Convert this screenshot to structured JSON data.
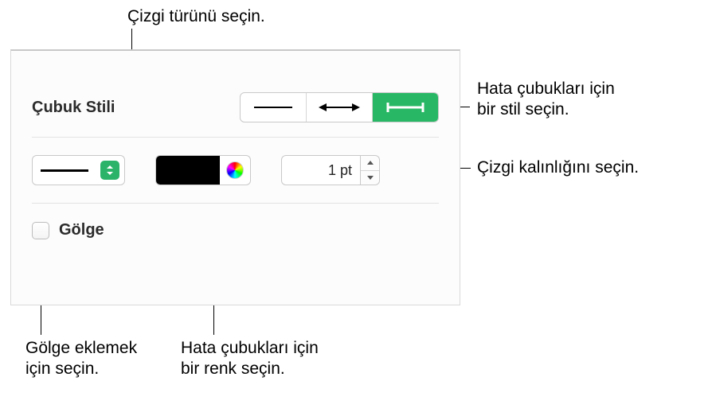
{
  "callouts": {
    "line_type": "Çizgi türünü seçin.",
    "bar_style_line1": "Hata çubukları için",
    "bar_style_line2": "bir stil seçin.",
    "thickness": "Çizgi kalınlığını seçin.",
    "shadow_line1": "Gölge eklemek",
    "shadow_line2": "için seçin.",
    "color_line1": "Hata çubukları için",
    "color_line2": "bir renk seçin."
  },
  "panel": {
    "section_title": "Çubuk Stili",
    "shadow_label": "Gölge",
    "thickness_value": "1 pt",
    "colors": {
      "accent": "#2cb36a",
      "swatch": "#000000"
    }
  }
}
